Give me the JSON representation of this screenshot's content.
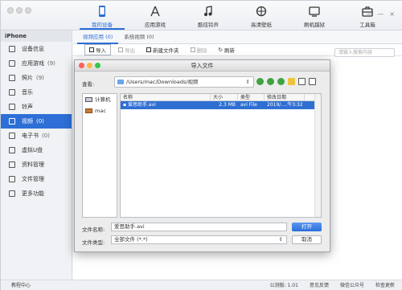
{
  "topnav": [
    {
      "label": "我的设备",
      "active": true,
      "icon": "phone-icon"
    },
    {
      "label": "应用游戏",
      "active": false,
      "icon": "apps-icon"
    },
    {
      "label": "酷炫铃声",
      "active": false,
      "icon": "music-note-icon"
    },
    {
      "label": "高清壁纸",
      "active": false,
      "icon": "wallpaper-icon"
    },
    {
      "label": "刷机越狱",
      "active": false,
      "icon": "flash-icon"
    },
    {
      "label": "工具箱",
      "active": false,
      "icon": "toolbox-icon"
    }
  ],
  "window_controls": [
    "~",
    "—",
    "×"
  ],
  "sidebar": {
    "device": "iPhone",
    "items": [
      {
        "label": "设备信息",
        "count": "",
        "icon": "device-info-icon"
      },
      {
        "label": "应用游戏",
        "count": "(9)",
        "icon": "apps-icon"
      },
      {
        "label": "照片",
        "count": "(9)",
        "icon": "photo-icon"
      },
      {
        "label": "音乐",
        "count": "",
        "icon": "music-icon"
      },
      {
        "label": "铃声",
        "count": "",
        "icon": "ringtone-icon"
      },
      {
        "label": "视频",
        "count": "(0)",
        "icon": "video-icon",
        "active": true
      },
      {
        "label": "电子书",
        "count": "(0)",
        "icon": "ebook-icon"
      },
      {
        "label": "虚拟U盘",
        "count": "",
        "icon": "usb-icon"
      },
      {
        "label": "资料管理",
        "count": "",
        "icon": "contacts-icon"
      },
      {
        "label": "文件管理",
        "count": "",
        "icon": "folder-icon"
      },
      {
        "label": "更多功能",
        "count": "",
        "icon": "more-icon"
      }
    ]
  },
  "tabs": [
    {
      "label": "视频应用 (0)",
      "active": true
    },
    {
      "label": "系统视频 (0)",
      "active": false
    }
  ],
  "toolbar": {
    "import": "导入",
    "export": "导出",
    "new_folder": "新建文件夹",
    "delete": "删除",
    "refresh": "刷新"
  },
  "search": {
    "placeholder": "请输入搜索内容"
  },
  "dialog": {
    "title": "导入文件",
    "look_in_label": "查看:",
    "path": "/Users/mac/Downloads/视频",
    "places": [
      {
        "label": "计算机",
        "icon": "computer-icon"
      },
      {
        "label": "mac",
        "icon": "home-icon"
      }
    ],
    "columns": [
      "名称",
      "大小",
      "类型",
      "修改日期"
    ],
    "files": [
      {
        "name": "爱思助手.avi",
        "size": "2.3 MB",
        "type": "avi File",
        "date": "2019/.…午3:32"
      }
    ],
    "filename_label": "文件名称:",
    "filename_value": "爱思助手.avi",
    "filetype_label": "文件类型:",
    "filetype_value": "全部文件 (*.*)",
    "open_button": "打开",
    "cancel_button": "取消"
  },
  "statusbar": {
    "left": "教程中心",
    "version": "公测版: 1.01",
    "feedback": "意见反馈",
    "wechat": "微信公众号",
    "update": "检查更新"
  },
  "colors": {
    "accent": "#2a6dd8",
    "selection": "#2f6fd2"
  }
}
